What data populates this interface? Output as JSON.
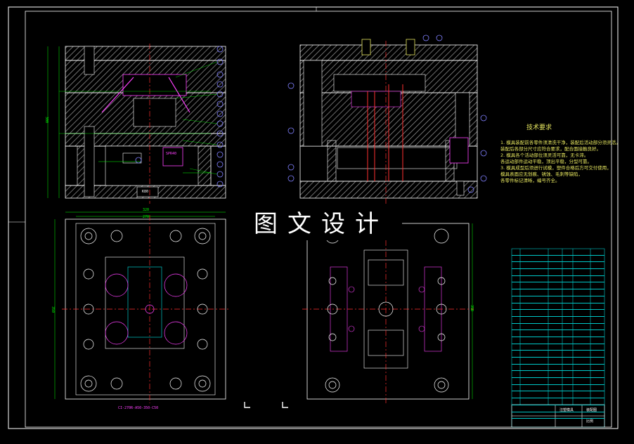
{
  "watermark": "图文设计",
  "tech_requirements": {
    "title": "技术要求",
    "lines": [
      "1. 模具装配前各零件须清洗干净，装配后活动部分须灵活。",
      "装配后各部分尺寸应符合要求，配合面接触良好。",
      "2. 模具各个活动部位须灵活可靠，无卡滞。",
      "各运动部件运动平稳，顶出平稳，分型可靠。",
      "3. 模具成型后须进行试模，塑件合格后方可交付使用，",
      "模具表面应无划痕、锈蚀、毛刺等缺陷，",
      "各零件标记清晰，编号齐全。"
    ]
  },
  "labels": {
    "spring": "SPR40",
    "cavity": "K80",
    "bottom_note": "CI-270R-A50-350-C50",
    "dim_width_outer": "320",
    "dim_width_inner": "270",
    "dim_height_left": "350",
    "dim_height_right": "350",
    "dim_total_height": "300"
  },
  "title_block": {
    "name_cell": "注塑模具",
    "right_cell": "装配图",
    "scale_cell": "比例"
  },
  "bom_rows": 25,
  "colors": {
    "outline": "#ffffff",
    "hatch": "#c8c8c8",
    "center": "#ff3030",
    "dimension": "#00ff00",
    "balloon": "#8080ff",
    "magenta": "#ff40ff",
    "yellow": "#e8e860",
    "cyan": "#00c8c8"
  }
}
